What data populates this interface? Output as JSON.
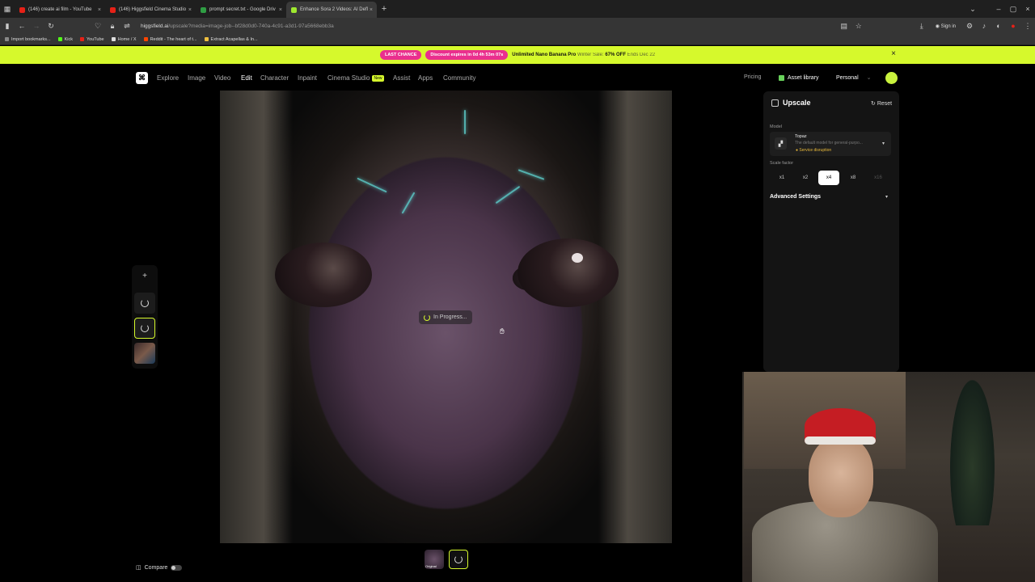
{
  "browser": {
    "tabs": [
      {
        "title": "(146) create ai film - YouTube",
        "color": "#e62117",
        "active": false
      },
      {
        "title": "(146) Higgsfield Cinema Studio",
        "color": "#e62117",
        "active": false
      },
      {
        "title": "prompt secret.txt - Google Driv",
        "color": "#2f9e44",
        "active": false
      },
      {
        "title": "Enhance Sora 2 Videos: AI Defl",
        "color": "#9fe82f",
        "active": true
      }
    ],
    "url_host": "higgsfield.ai",
    "url_path": "/upscale?media=image-job--bf28d0d0-740a-4c91-a3d1-97a5668ebb3a",
    "sign_in": "Sign in",
    "bookmarks": [
      {
        "label": "Import bookmarks...",
        "color": "#888"
      },
      {
        "label": "Kick",
        "color": "#53fc18"
      },
      {
        "label": "YouTube",
        "color": "#e62117"
      },
      {
        "label": "Home / X",
        "color": "#ddd"
      },
      {
        "label": "Reddit - The heart of t...",
        "color": "#ff4500"
      },
      {
        "label": "Extract Acapellas & In...",
        "color": "#f0c040"
      }
    ]
  },
  "promo": {
    "badge1": "LAST CHANCE",
    "badge2": "Discount expires in 0d 4h 53m 07s",
    "headline": "Unlimited Nano Banana Pro",
    "sub": "Winter Sale:",
    "offer": "67% OFF",
    "ends": "Ends Dec 22"
  },
  "nav": {
    "links": [
      "Explore",
      "Image",
      "Video",
      "Edit",
      "Character",
      "Inpaint",
      "Cinema Studio",
      "Assist",
      "Apps",
      "Community"
    ],
    "new_badge": "New",
    "pricing": "Pricing",
    "asset_library": "Asset library",
    "workspace": "Personal"
  },
  "canvas": {
    "status": "In Progress..."
  },
  "bottom": {
    "compare": "Compare",
    "original_label": "Original"
  },
  "panel": {
    "title": "Upscale",
    "reset": "Reset",
    "model_label": "Model",
    "model_name": "Topaz",
    "model_desc": "The default model for general-purpo...",
    "model_status": "Service disruption",
    "scale_label": "Scale factor",
    "scales": [
      "x1",
      "x2",
      "x4",
      "x8",
      "x16"
    ],
    "scale_selected": "x4",
    "advanced": "Advanced Settings"
  }
}
